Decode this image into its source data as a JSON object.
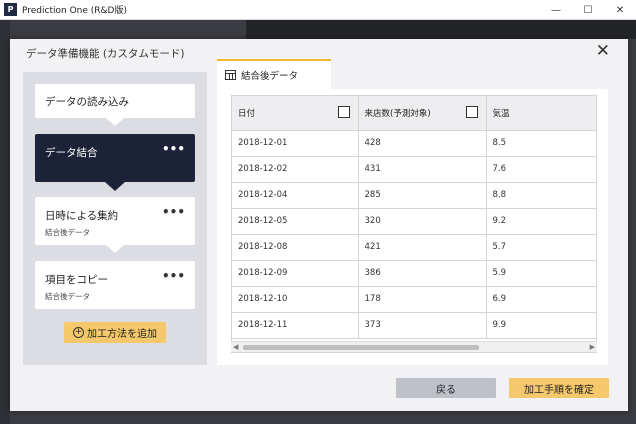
{
  "window": {
    "title": "Prediction One (R&D版)",
    "logo": "P",
    "controls": {
      "minimize": "—",
      "maximize": "☐",
      "close": "✕"
    }
  },
  "modal": {
    "title": "データ準備機能 (カスタムモード)",
    "close_icon": "✕"
  },
  "steps": [
    {
      "label": "データの読み込み",
      "sub": "",
      "active": false
    },
    {
      "label": "データ結合",
      "sub": "",
      "active": true,
      "menu": "•••"
    },
    {
      "label": "日時による集約",
      "sub": "結合後データ",
      "active": false,
      "menu": "•••"
    },
    {
      "label": "項目をコピー",
      "sub": "結合後データ",
      "active": false,
      "menu": "•••"
    }
  ],
  "add_button": {
    "icon": "+",
    "label": "加工方法を追加"
  },
  "tab": {
    "label": "結合後データ",
    "icon": "table-icon"
  },
  "table": {
    "columns": [
      "日付",
      "来店数(予測対象)",
      "気温"
    ],
    "rows": [
      [
        "2018-12-01",
        "428",
        "8.5"
      ],
      [
        "2018-12-02",
        "431",
        "7.6"
      ],
      [
        "2018-12-04",
        "285",
        "8.8"
      ],
      [
        "2018-12-05",
        "320",
        "9.2"
      ],
      [
        "2018-12-08",
        "421",
        "5.7"
      ],
      [
        "2018-12-09",
        "386",
        "5.9"
      ],
      [
        "2018-12-10",
        "178",
        "6.9"
      ],
      [
        "2018-12-11",
        "373",
        "9.9"
      ]
    ]
  },
  "footer": {
    "back_label": "戻る",
    "confirm_label": "加工手順を確定"
  },
  "colors": {
    "accent": "#f5c96b",
    "active_step": "#1c2238",
    "tab_border": "#f2b933"
  }
}
